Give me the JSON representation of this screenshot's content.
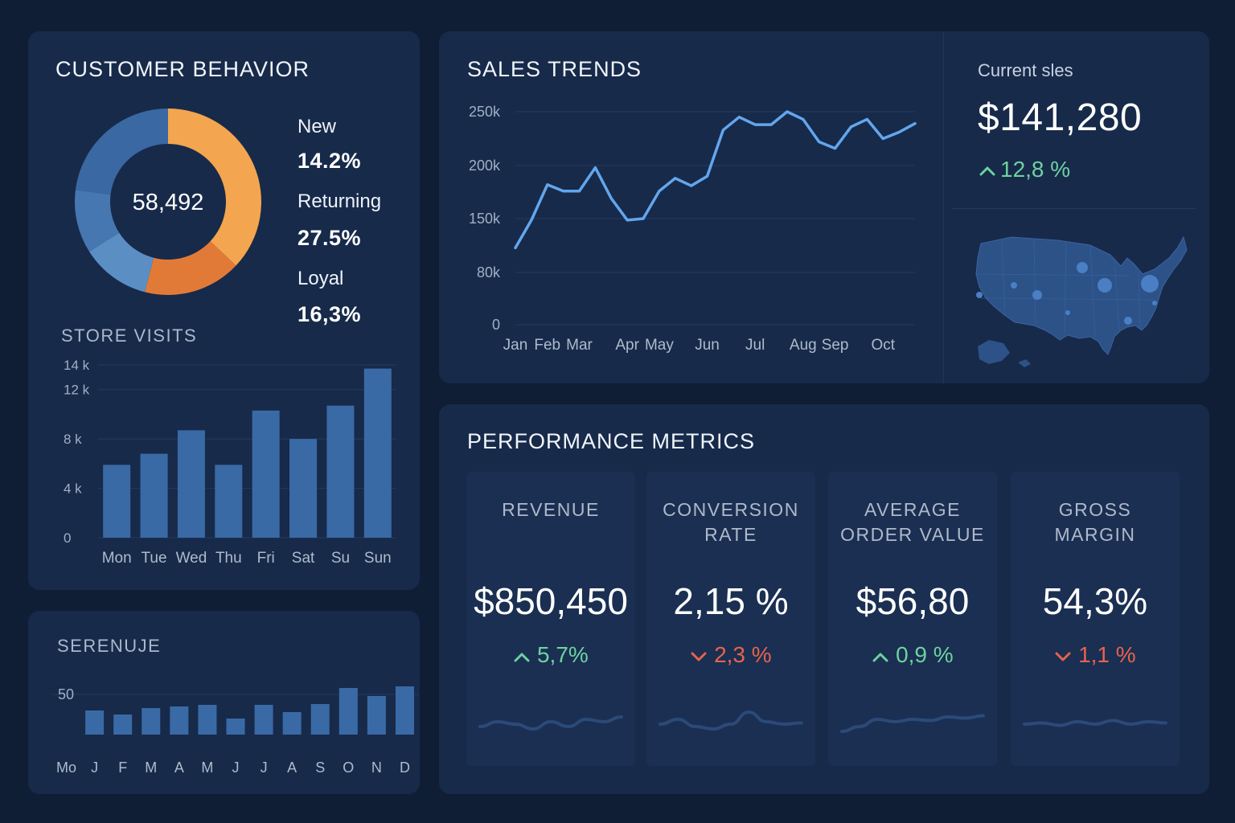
{
  "colors": {
    "background": "#0f1e35",
    "panel": "#172a4a",
    "line": "#62a6ee",
    "bar": "#3a6aa5",
    "positive": "#6fd1a0",
    "negative": "#e8624e",
    "donut_orange_light": "#f4a54f",
    "donut_orange_dark": "#e27a37",
    "donut_blue_dark": "#3a68a3",
    "donut_blue_mid": "#4677b0",
    "donut_blue_light": "#5b8fc4"
  },
  "customer_behavior": {
    "title": "CUSTOMER BEHAVIOR",
    "total": "58,492",
    "legend": [
      {
        "label": "New",
        "value": "14.2%"
      },
      {
        "label": "Returning",
        "value": "27.5%"
      },
      {
        "label": "Loyal",
        "value": "16,3%"
      }
    ]
  },
  "store_visits": {
    "title": "STORE VISITS"
  },
  "serenuje": {
    "title": "SERENUJE"
  },
  "sales_trends": {
    "title": "SALES TRENDS"
  },
  "current_sales": {
    "label": "Current sles",
    "value": "$141,280",
    "change": "12,8 %",
    "change_direction": "up",
    "map_icon": "usa-map-icon"
  },
  "performance": {
    "title": "PERFORMANCE METRICS",
    "metrics": [
      {
        "title": "REVENUE",
        "value": "$850,450",
        "change": "5,7%",
        "direction": "up"
      },
      {
        "title": "CONVERSION\nRATE",
        "value": "2,15 %",
        "change": "2,3 %",
        "direction": "down"
      },
      {
        "title": "AVERAGE\nORDER VALUE",
        "value": "$56,80",
        "change": "0,9 %",
        "direction": "up"
      },
      {
        "title": "GROSS\nMARGIN",
        "value": "54,3%",
        "change": "1,1 %",
        "direction": "down"
      }
    ]
  },
  "chart_data": [
    {
      "id": "customer_behavior",
      "type": "pie",
      "title": "CUSTOMER BEHAVIOR",
      "center_label": "58,492",
      "slices": [
        {
          "value": 37,
          "color": "#f4a54f"
        },
        {
          "value": 17,
          "color": "#e27a37"
        },
        {
          "value": 12,
          "color": "#5b8fc4"
        },
        {
          "value": 11,
          "color": "#4677b0"
        },
        {
          "value": 23,
          "color": "#3a68a3"
        }
      ]
    },
    {
      "id": "store_visits",
      "type": "bar",
      "title": "STORE VISITS",
      "categories": [
        "Mon",
        "Tue",
        "Wed",
        "Thu",
        "Fri",
        "Sat",
        "Su",
        "Sun"
      ],
      "values": [
        5900,
        6800,
        8700,
        5900,
        10300,
        8000,
        10700,
        13700
      ],
      "yticks": [
        {
          "value": 0,
          "label": "0"
        },
        {
          "value": 4000,
          "label": "4 k"
        },
        {
          "value": 8000,
          "label": "8 k"
        },
        {
          "value": 12000,
          "label": "12 k"
        },
        {
          "value": 14000,
          "label": "14 k"
        }
      ],
      "ylim": [
        0,
        14000
      ],
      "grid": true
    },
    {
      "id": "serenuje",
      "type": "bar",
      "title": "SERENUJE",
      "categories": [
        "Mo",
        "J",
        "F",
        "M",
        "A",
        "M",
        "J",
        "J",
        "A",
        "S",
        "O",
        "N",
        "D"
      ],
      "values": [
        null,
        30,
        25,
        33,
        35,
        37,
        20,
        37,
        28,
        38,
        58,
        48,
        60
      ],
      "yticks": [
        {
          "value": 50,
          "label": "50"
        }
      ],
      "ylim": [
        0,
        70
      ],
      "grid": true
    },
    {
      "id": "sales_trends",
      "type": "line",
      "title": "SALES TRENDS",
      "x": [
        "Jan",
        "",
        "Feb",
        "",
        "Mar",
        "",
        "",
        "Apr",
        "",
        "May",
        "",
        "",
        "Jun",
        "",
        "",
        "Jul",
        "",
        "",
        "Aug",
        "",
        "Sep",
        "",
        "",
        "Oct",
        "",
        ""
      ],
      "xticks": [
        "Jan",
        "Feb",
        "Mar",
        "Apr",
        "May",
        "Jun",
        "Jul",
        "Aug",
        "Sep",
        "Oct"
      ],
      "series": [
        {
          "values": [
            112000,
            148000,
            182000,
            176000,
            176000,
            198000,
            169000,
            148000,
            150000,
            176000,
            188000,
            181000,
            190000,
            233000,
            245000,
            238000,
            238000,
            252000,
            243000,
            222000,
            216000,
            236000,
            243000,
            225000,
            231000,
            239000
          ],
          "color": "#62a6ee"
        }
      ],
      "yticks": [
        {
          "value": 0,
          "label": "0"
        },
        {
          "value": 80000,
          "label": "80k"
        },
        {
          "value": 150000,
          "label": "150k"
        },
        {
          "value": 200000,
          "label": "200k"
        },
        {
          "value": 250000,
          "label": "250k"
        }
      ],
      "ylim": [
        0,
        250000
      ],
      "grid": true
    },
    {
      "id": "sparklines",
      "type": "line",
      "series": [
        {
          "values": [
            0.3,
            0.5,
            0.4,
            0.2,
            0.5,
            0.3,
            0.6,
            0.5,
            0.7
          ]
        },
        {
          "values": [
            0.4,
            0.6,
            0.3,
            0.2,
            0.4,
            0.9,
            0.5,
            0.4,
            0.45
          ]
        },
        {
          "values": [
            0.1,
            0.3,
            0.6,
            0.5,
            0.6,
            0.55,
            0.7,
            0.65,
            0.75
          ]
        },
        {
          "values": [
            0.4,
            0.45,
            0.35,
            0.5,
            0.4,
            0.55,
            0.4,
            0.5,
            0.45
          ]
        }
      ]
    }
  ]
}
